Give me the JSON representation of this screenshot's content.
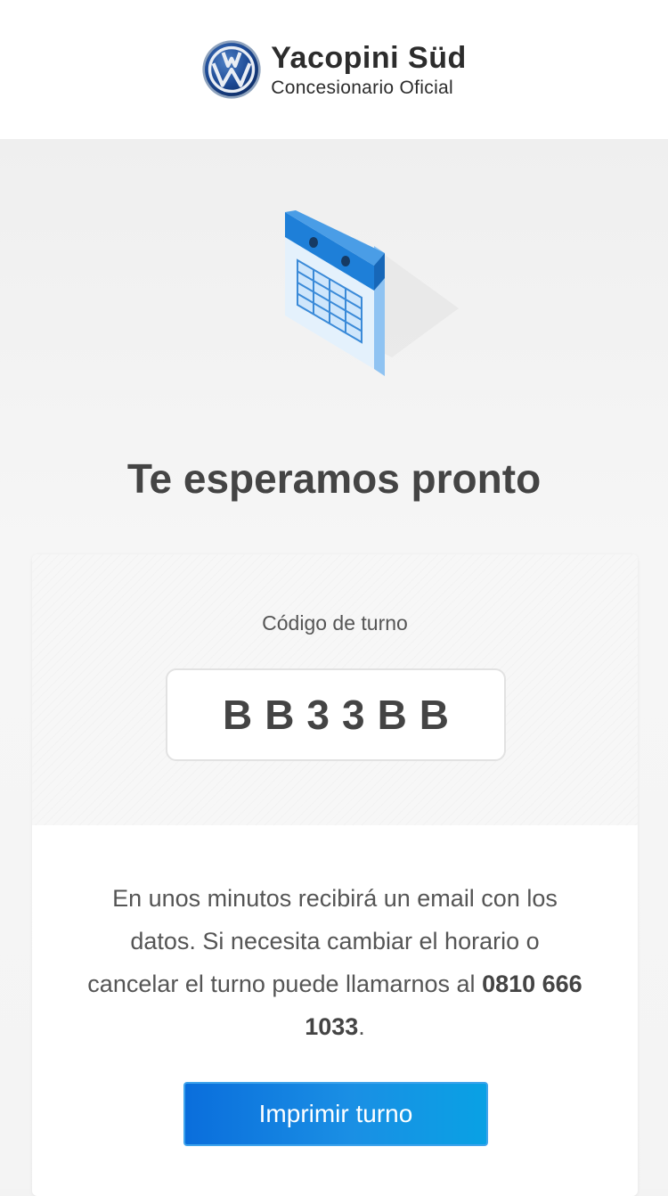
{
  "header": {
    "brand_name": "Yacopini Süd",
    "brand_subtitle": "Concesionario Oficial",
    "logo_icon": "vw-logo-icon"
  },
  "hero": {
    "icon": "calendar-icon",
    "title": "Te esperamos pronto"
  },
  "card": {
    "code_label": "Código de turno",
    "code_value": "BB33BB",
    "message_text": "En unos minutos recibirá un email con los datos. Si necesita cambiar el horario o cancelar el turno puede llamarnos al ",
    "phone": "0810 666 1033",
    "message_end": ".",
    "print_button_label": "Imprimir turno"
  },
  "colors": {
    "accent": "#0a6edc",
    "accent_light": "#09a1e4",
    "calendar_blue": "#1f7fd6",
    "text": "#444444"
  }
}
